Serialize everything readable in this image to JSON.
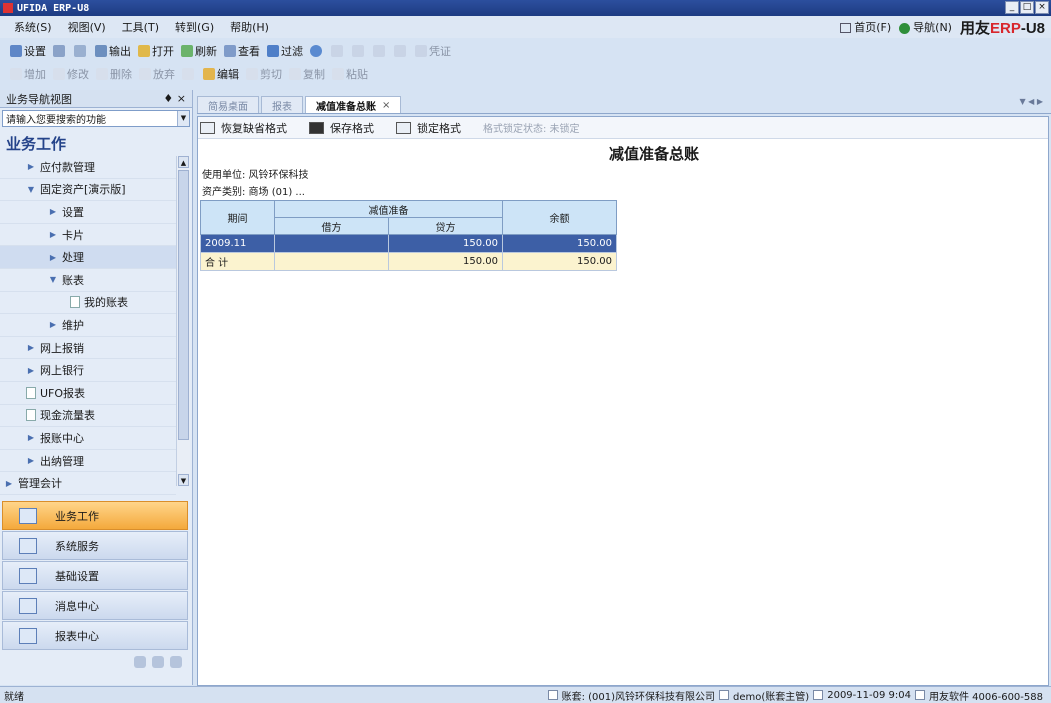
{
  "window": {
    "title": "UFIDA ERP-U8",
    "min": "_",
    "max": "□",
    "close": "×"
  },
  "menu": {
    "items": [
      "系统(S)",
      "视图(V)",
      "工具(T)",
      "转到(G)",
      "帮助(H)"
    ],
    "home": "首页(F)",
    "nav": "导航(N)",
    "brand_prefix": "用友",
    "brand_erp": "ERP",
    "brand_suffix": "-U8"
  },
  "toolbar1": [
    "设置",
    "",
    "",
    "输出",
    "打开",
    "刷新",
    "查看",
    "过滤",
    "",
    "",
    "",
    "",
    "",
    "凭证"
  ],
  "toolbar2": [
    "增加",
    "修改",
    "删除",
    "放弃",
    "",
    "编辑",
    "剪切",
    "复制",
    "粘贴"
  ],
  "sidebar": {
    "header": "业务导航视图",
    "pin": "♦ ×",
    "search_placeholder": "请输入您要搜索的功能",
    "section": "业务工作",
    "tree": [
      {
        "label": "应付款管理",
        "type": "arrow",
        "indent": 1
      },
      {
        "label": "固定资产[演示版]",
        "type": "down",
        "indent": 1
      },
      {
        "label": "设置",
        "type": "arrow",
        "indent": 2
      },
      {
        "label": "卡片",
        "type": "arrow",
        "indent": 2
      },
      {
        "label": "处理",
        "type": "arrow",
        "indent": 2,
        "selected": true
      },
      {
        "label": "账表",
        "type": "down",
        "indent": 2
      },
      {
        "label": "我的账表",
        "type": "leaf",
        "indent": 3
      },
      {
        "label": "维护",
        "type": "arrow",
        "indent": 2
      },
      {
        "label": "网上报销",
        "type": "arrow",
        "indent": 1
      },
      {
        "label": "网上银行",
        "type": "arrow",
        "indent": 1
      },
      {
        "label": "UFO报表",
        "type": "leaf",
        "indent": 1
      },
      {
        "label": "现金流量表",
        "type": "leaf",
        "indent": 1
      },
      {
        "label": "报账中心",
        "type": "arrow",
        "indent": 1
      },
      {
        "label": "出纳管理",
        "type": "arrow",
        "indent": 1
      },
      {
        "label": "管理会计",
        "type": "arrow",
        "indent": 0
      }
    ],
    "nav_buttons": [
      "业务工作",
      "系统服务",
      "基础设置",
      "消息中心",
      "报表中心"
    ]
  },
  "tabs": [
    {
      "label": "简易桌面",
      "active": false
    },
    {
      "label": "报表",
      "active": false
    },
    {
      "label": "减值准备总账",
      "active": true
    }
  ],
  "tab_close": "×",
  "tab_arrows": "▼ ◀ ▶",
  "report": {
    "toolbar": [
      "恢复缺省格式",
      "保存格式",
      "锁定格式"
    ],
    "status": "格式锁定状态: 未锁定",
    "title": "减值准备总账",
    "unit": "使用单位: 风铃环保科技",
    "asset_class": "资产类别: 商场 (01) ...",
    "headers": {
      "period": "期间",
      "group": "减值准备",
      "debit": "借方",
      "credit": "贷方",
      "balance": "余额"
    },
    "rows": [
      {
        "period": "2009.11",
        "debit": "",
        "credit": "150.00",
        "balance": "150.00"
      }
    ],
    "total": {
      "label": "合 计",
      "debit": "",
      "credit": "150.00",
      "balance": "150.00"
    }
  },
  "status": {
    "ready": "就绪",
    "account": "账套: (001)风铃环保科技有限公司",
    "user": "demo(账套主管)",
    "datetime": "2009-11-09 9:04",
    "vendor": "用友软件 4006-600-588"
  },
  "colors": {
    "accent": "#3d5fa6",
    "orange": "#f4a93c",
    "total_bg": "#fbf3cf",
    "header_bg": "#cde4f7"
  }
}
